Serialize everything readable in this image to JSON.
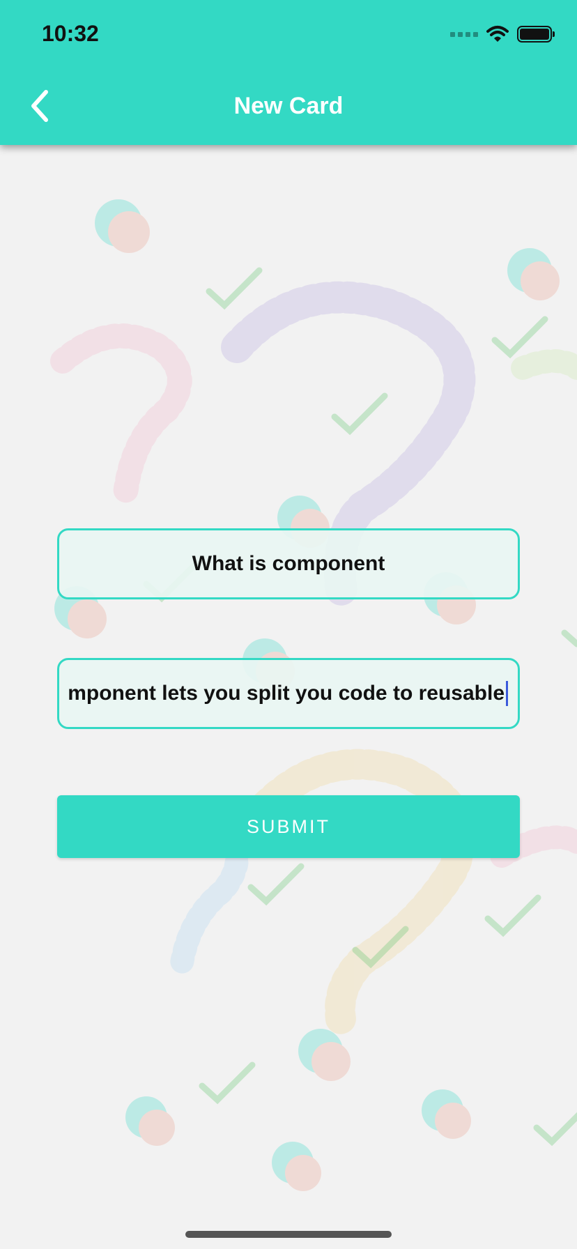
{
  "status_bar": {
    "time": "10:32"
  },
  "header": {
    "title": "New Card",
    "back_icon": "chevron-left-icon"
  },
  "form": {
    "front_value": "What is component",
    "back_value": "Component lets you split you code to reusable",
    "back_visible": "mponent lets you split you code to reusable",
    "submit_label": "SUBMIT"
  },
  "colors": {
    "accent": "#33d9c4",
    "background": "#f2f2f2"
  }
}
